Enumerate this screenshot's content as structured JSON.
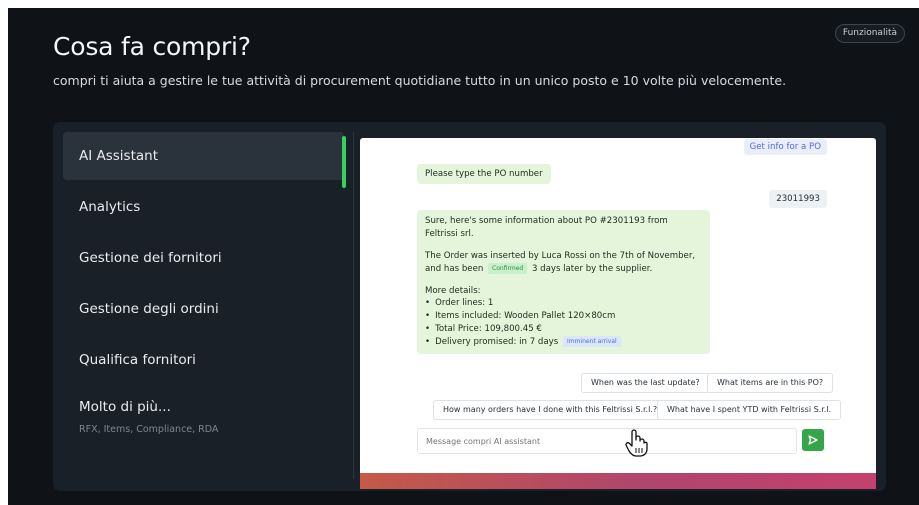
{
  "header": {
    "title": "Cosa fa compri?",
    "badge": "Funzionalità",
    "subtitle": "compri ti aiuta a gestire le tue attività di procurement quotidiane tutto in un unico posto e 10 volte più velocemente."
  },
  "sidebar": {
    "items": [
      {
        "label": "AI Assistant",
        "active": true
      },
      {
        "label": "Analytics"
      },
      {
        "label": "Gestione dei fornitori"
      },
      {
        "label": "Gestione degli ordini"
      },
      {
        "label": "Qualifica fornitori"
      },
      {
        "label": "Molto di più...",
        "sub": "RFX, Items, Compliance, RDA"
      }
    ]
  },
  "chat": {
    "top_chip": "Get info for a PO",
    "bot_prompt": "Please type the PO number",
    "user_reply": "23011993",
    "info": {
      "line1": "Sure, here's some information about PO #2301193 from Feltrissi srl.",
      "line2a": "The Order was inserted by Luca Rossi on the 7th of November, and has been",
      "tag_confirmed": "Confirmed",
      "line2b": "3 days later by the supplier.",
      "details_title": "More details:",
      "details": [
        "Order lines: 1",
        "Items included: Wooden Pallet 120×80cm",
        "Total Price: 109,800.45 €",
        "Delivery promised: in 7 days"
      ],
      "tag_imminent": "Imminent arrival"
    },
    "suggestions": [
      "When was the last update?",
      "What items are in this PO?",
      "How many orders have I done with this Feltrissi S.r.l.?",
      "What have I spent YTD with Feltrissi S.r.l."
    ],
    "input_placeholder": "Message compri AI assistant"
  },
  "colors": {
    "accent_green": "#37d05c",
    "bubble_green": "#e4f5dc",
    "background": "#0f1318",
    "panel": "#1a2028"
  },
  "icons": {
    "send": "send-arrow-icon",
    "cursor": "hand-pointer-icon"
  }
}
